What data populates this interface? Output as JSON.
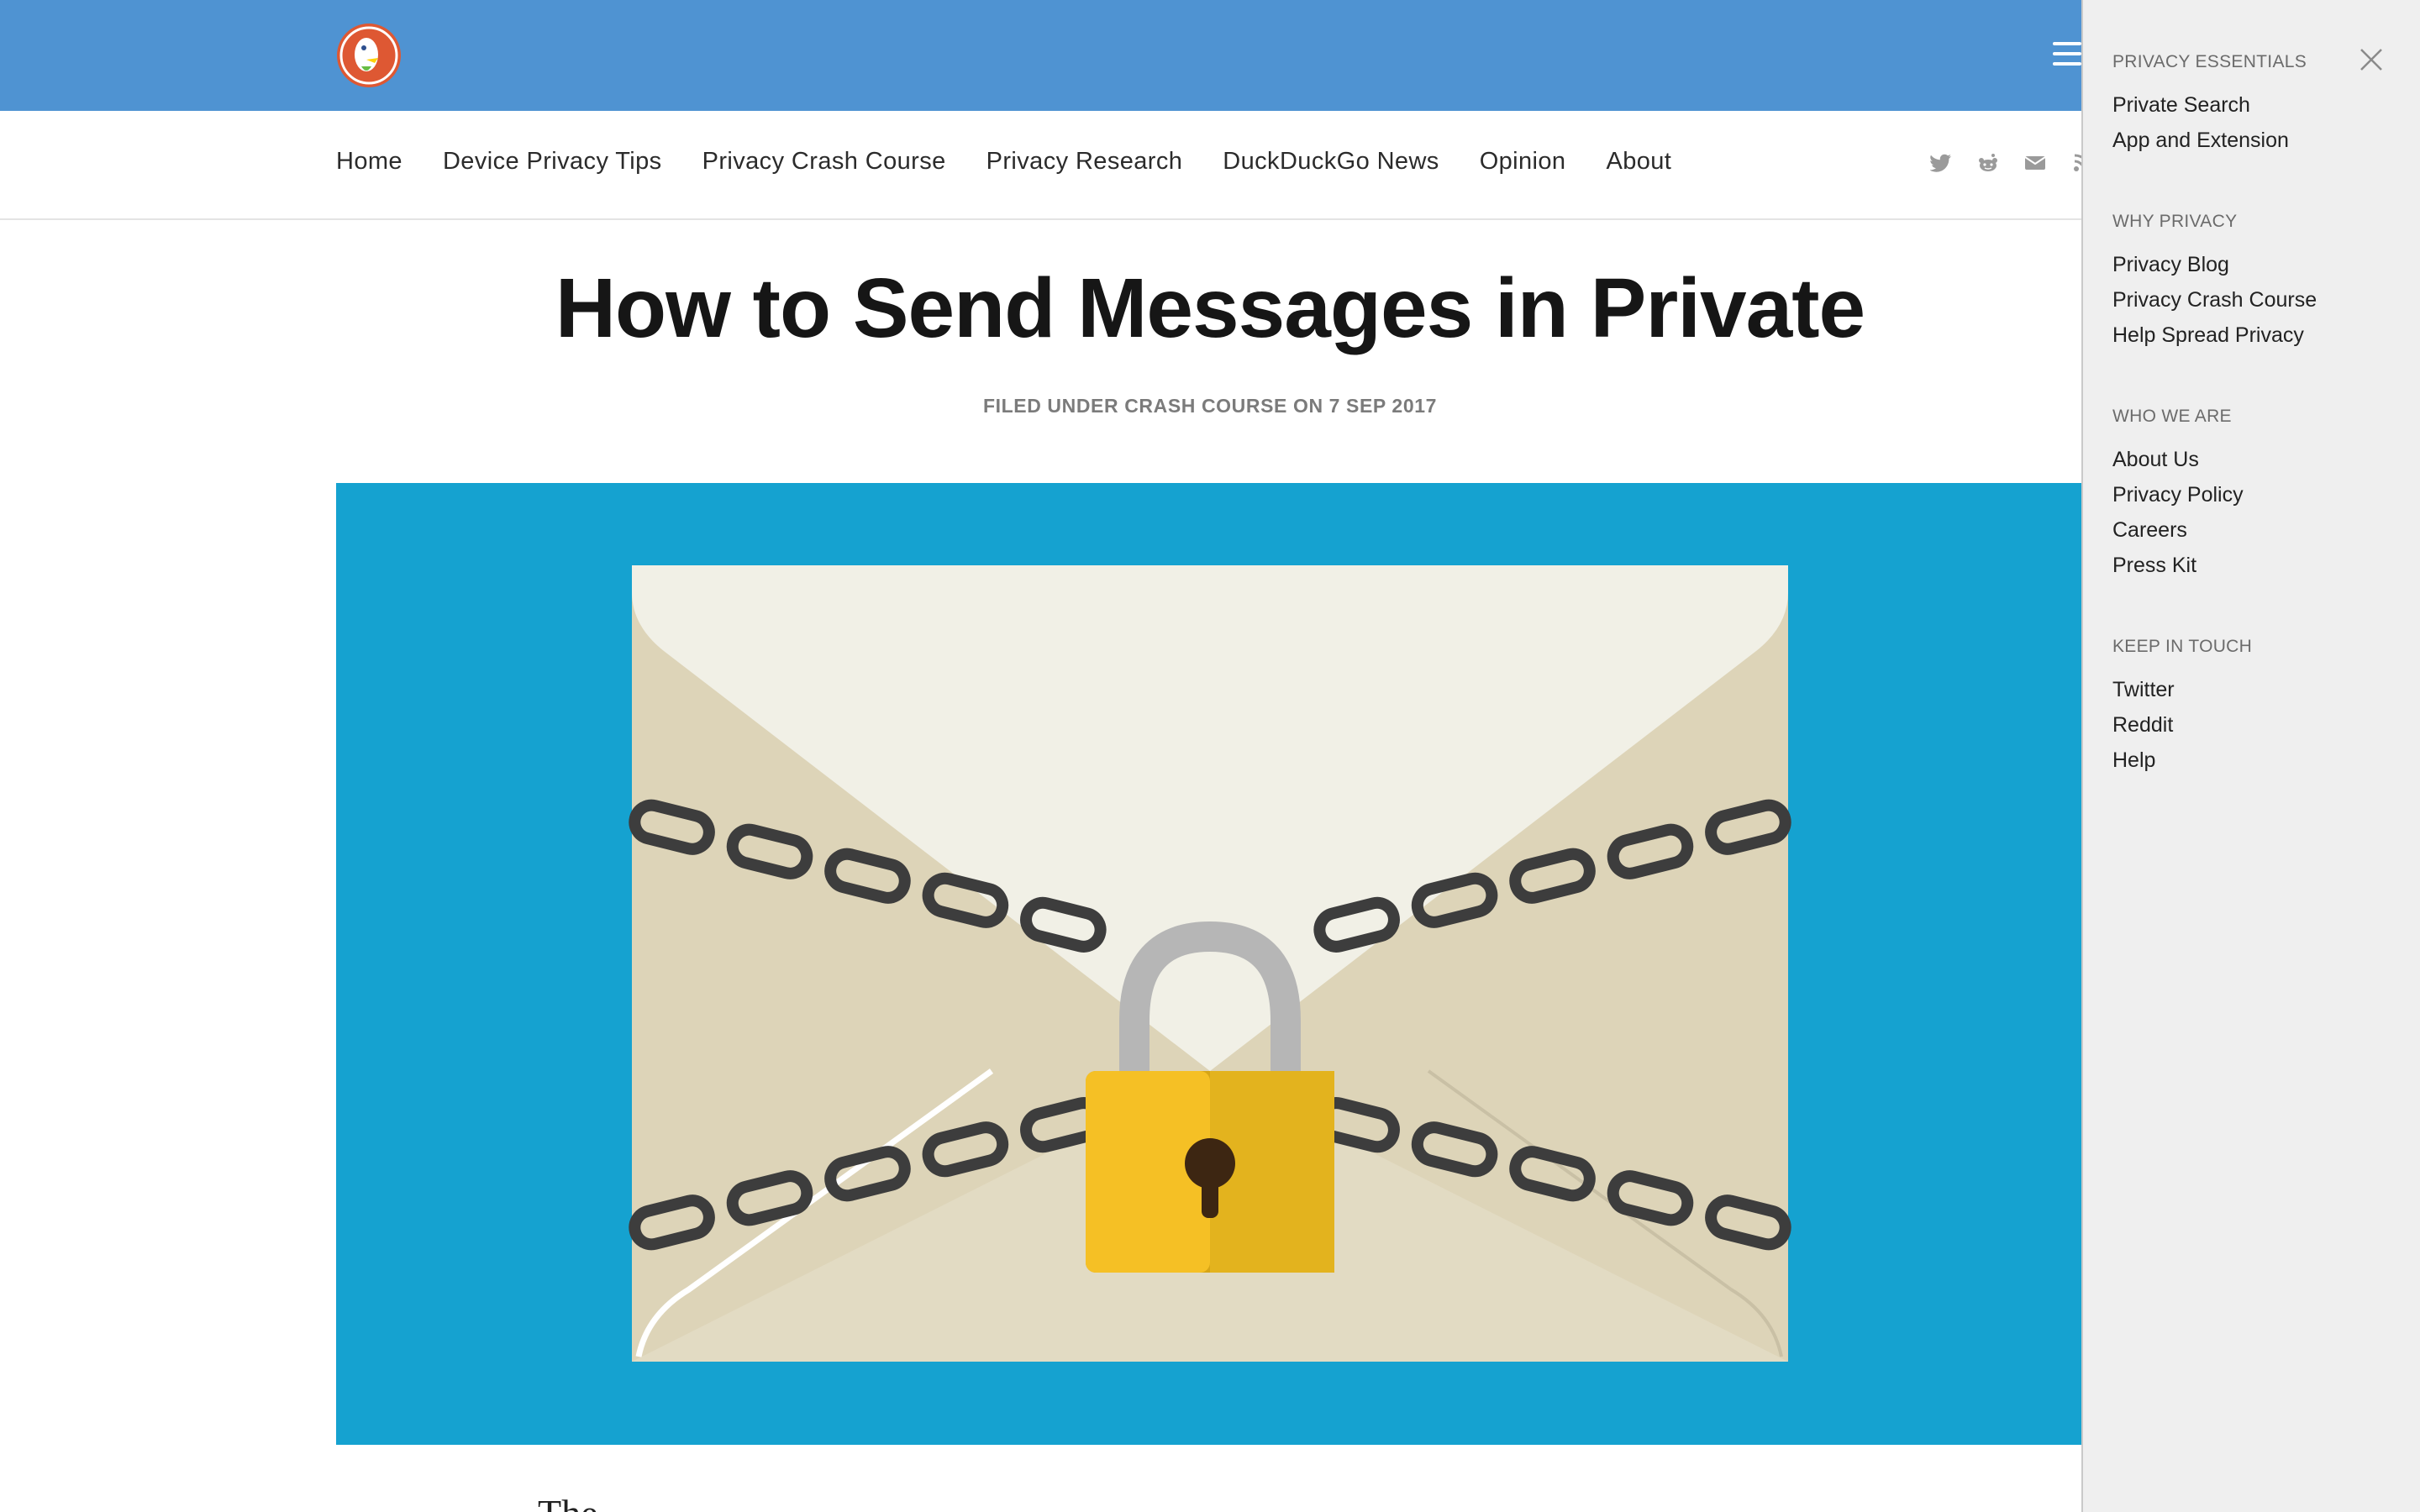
{
  "header": {
    "logo_alt": "DuckDuckGo",
    "menu_icon": "hamburger-menu-icon"
  },
  "nav": {
    "items": [
      {
        "label": "Home"
      },
      {
        "label": "Device Privacy Tips"
      },
      {
        "label": "Privacy Crash Course"
      },
      {
        "label": "Privacy Research"
      },
      {
        "label": "DuckDuckGo News"
      },
      {
        "label": "Opinion"
      },
      {
        "label": "About"
      }
    ],
    "social": [
      "twitter-icon",
      "reddit-icon",
      "email-icon",
      "rss-icon"
    ]
  },
  "article": {
    "title": "How to Send Messages in Private",
    "meta": "FILED UNDER CRASH COURSE ON 7 SEP 2017",
    "body_snippet": "The..."
  },
  "drawer": {
    "close_icon": "close-icon",
    "sections": [
      {
        "heading": "PRIVACY ESSENTIALS",
        "links": [
          "Private Search",
          "App and Extension"
        ]
      },
      {
        "heading": "WHY PRIVACY",
        "links": [
          "Privacy Blog",
          "Privacy Crash Course",
          "Help Spread Privacy"
        ]
      },
      {
        "heading": "WHO WE ARE",
        "links": [
          "About Us",
          "Privacy Policy",
          "Careers",
          "Press Kit"
        ]
      },
      {
        "heading": "KEEP IN TOUCH",
        "links": [
          "Twitter",
          "Reddit",
          "Help"
        ]
      }
    ]
  },
  "colors": {
    "header_bg": "#4f93d2",
    "hero_bg": "#15a2d0",
    "drawer_bg": "#efefef",
    "lock_gold": "#f5c025"
  }
}
